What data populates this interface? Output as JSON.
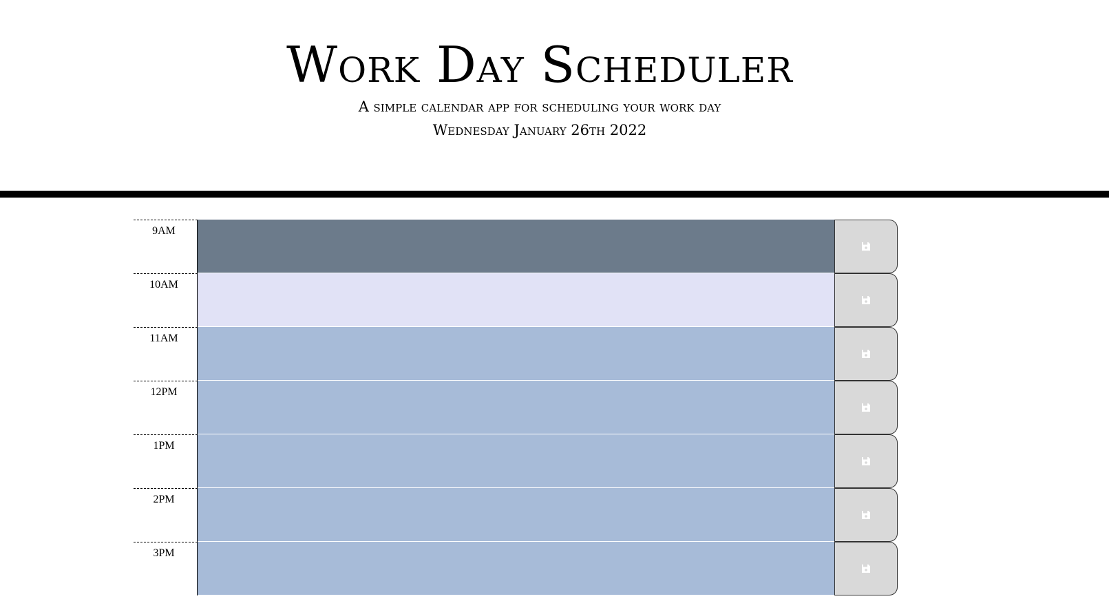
{
  "header": {
    "title": "Work Day Scheduler",
    "subtitle": "A simple calendar app for scheduling your work day",
    "current_day": "Wednesday January 26th 2022"
  },
  "colors": {
    "past": "#6c7b8b",
    "present": "#e1e2f6",
    "future": "#a7bbd8",
    "save_button": "#d9d9d9",
    "divider": "#000000"
  },
  "time_blocks": [
    {
      "hour": "9AM",
      "status": "past",
      "text": "",
      "save_icon": "floppy-disk-icon"
    },
    {
      "hour": "10AM",
      "status": "present",
      "text": "",
      "save_icon": "floppy-disk-icon"
    },
    {
      "hour": "11AM",
      "status": "future",
      "text": "",
      "save_icon": "floppy-disk-icon"
    },
    {
      "hour": "12PM",
      "status": "future",
      "text": "",
      "save_icon": "floppy-disk-icon"
    },
    {
      "hour": "1PM",
      "status": "future",
      "text": "",
      "save_icon": "floppy-disk-icon"
    },
    {
      "hour": "2PM",
      "status": "future",
      "text": "",
      "save_icon": "floppy-disk-icon"
    },
    {
      "hour": "3PM",
      "status": "future",
      "text": "",
      "save_icon": "floppy-disk-icon"
    }
  ]
}
